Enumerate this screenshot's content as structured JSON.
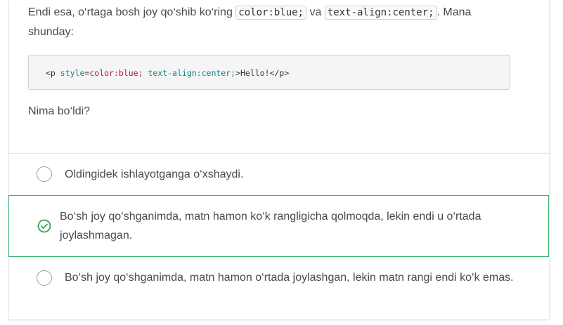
{
  "prompt": {
    "text_before": "Endi esa, o‘rtaga bosh joy qo‘shib ko‘ring ",
    "code1": "color:blue;",
    "text_mid": " va ",
    "code2": "text-align:center;",
    "text_after": ". Mana shunday:"
  },
  "code_block": {
    "open_tag": "<p ",
    "attr_name": "style",
    "eq": "=",
    "value": "color:blue;",
    "rest": " text-align:center;",
    "close": ">Hello!</p>"
  },
  "question": "Nima bo‘ldi?",
  "options": [
    {
      "text": "Oldingidek ishlayotganga o‘xshaydi.",
      "state": "unselected"
    },
    {
      "text": "Bo‘sh joy qo‘shganimda, matn hamon ko‘k rangligicha qolmoqda, lekin endi u o‘rtada joylashmagan.",
      "state": "correct"
    },
    {
      "text": "Bo‘sh joy qo‘shganimda, matn hamon o‘rtada joylashgan, lekin matn rangi endi ko‘k emas.",
      "state": "unselected"
    }
  ],
  "colors": {
    "correct_border": "#3cb371",
    "correct_icon": "#2ea44f"
  }
}
